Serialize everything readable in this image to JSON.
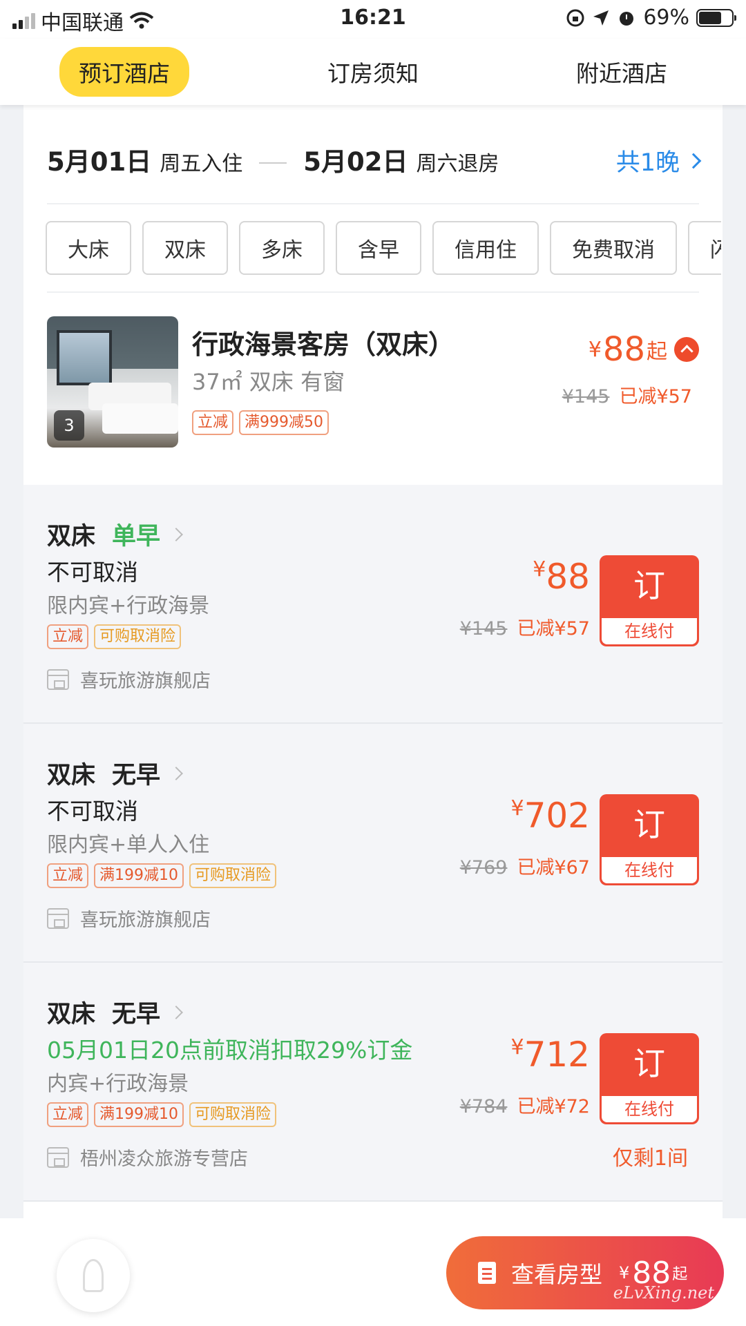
{
  "status_bar": {
    "carrier": "中国联通",
    "time": "16:21",
    "battery": "69%",
    "battery_level": 0.69
  },
  "top_tabs": [
    {
      "label": "预订酒店",
      "active": true
    },
    {
      "label": "订房须知",
      "active": false
    },
    {
      "label": "附近酒店",
      "active": false
    }
  ],
  "dates": {
    "checkin_date": "5月01日",
    "checkin_label": "周五入住",
    "checkout_date": "5月02日",
    "checkout_label": "周六退房",
    "nights": "共1晚"
  },
  "filters": [
    "大床",
    "双床",
    "多床",
    "含早",
    "信用住",
    "免费取消",
    "闪"
  ],
  "room": {
    "title": "行政海景客房（双床）",
    "desc": "37㎡ 双床 有窗",
    "photo_count": "3",
    "tags": [
      "立减",
      "满999减50"
    ],
    "price_currency": "¥",
    "price": "88",
    "price_suffix": "起",
    "orig_price": "¥145",
    "discount": "已减¥57"
  },
  "rates": [
    {
      "bed": "双床",
      "meal": "单早",
      "policy": "不可取消",
      "restriction": "限内宾+行政海景",
      "tags": [
        "立减",
        "可购取消险"
      ],
      "shop": "喜玩旅游旗舰店",
      "currency": "¥",
      "price": "88",
      "orig_price": "¥145",
      "discount": "已减¥57",
      "book_label": "订",
      "pay_label": "在线付"
    },
    {
      "bed": "双床",
      "meal": "无早",
      "policy": "不可取消",
      "restriction": "限内宾+单人入住",
      "tags": [
        "立减",
        "满199减10",
        "可购取消险"
      ],
      "shop": "喜玩旅游旗舰店",
      "currency": "¥",
      "price": "702",
      "orig_price": "¥769",
      "discount": "已减¥67",
      "book_label": "订",
      "pay_label": "在线付"
    },
    {
      "bed": "双床",
      "meal": "无早",
      "policy": "05月01日20点前取消扣取29%订金",
      "restriction": "内宾+行政海景",
      "tags": [
        "立减",
        "满199减10",
        "可购取消险"
      ],
      "shop": "梧州凌众旅游专营店",
      "currency": "¥",
      "price": "712",
      "orig_price": "¥784",
      "discount": "已减¥72",
      "book_label": "订",
      "pay_label": "在线付",
      "remaining": "仅剩1间"
    }
  ],
  "bottom_bar": {
    "view_label": "查看房型",
    "currency": "¥",
    "price": "88",
    "price_suffix": "起",
    "watermark": "eLvXing.net"
  },
  "colors": {
    "accent_yellow": "#ffd83a",
    "price_orange": "#f05a2b",
    "book_red": "#ee4b36",
    "link_blue": "#2a8be8",
    "green": "#3fb55b"
  }
}
